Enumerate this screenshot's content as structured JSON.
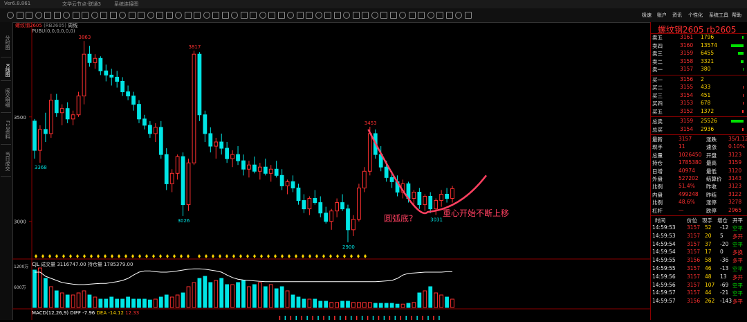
{
  "topbar": {
    "app": "Ver6.8.861",
    "account": "文华云节点-联通3",
    "status": "系统连接图"
  },
  "menu": [
    "极速",
    "账户",
    "资讯",
    "个性化",
    "系统工具",
    "帮助"
  ],
  "sidebar_tabs": [
    "分时图",
    "K线图",
    "成交明细",
    "F10资料",
    "当日成交"
  ],
  "chart_header": {
    "name": "螺纹钢2605",
    "ref": "(RB2605)",
    "period": "周线",
    "indicator": "PUBU(0,0,0,0,0,0)"
  },
  "annotations": {
    "high1": "3863",
    "high2": "3817",
    "high3": "3453",
    "low1": "3368",
    "low2": "3026",
    "low3": "3031",
    "low4": "2900",
    "arc_label": "圆弧底?",
    "trend_label": "重心开始不断上移"
  },
  "price_axis": [
    "3500",
    "3000"
  ],
  "volume_header": {
    "label": "CJL",
    "volume_text": "成交量 3116747.00",
    "oi_text": "持仓量 1785379.00"
  },
  "volume_axis": [
    "1200万",
    "600万"
  ],
  "macd_header": {
    "label": "MACD(12,26,9)",
    "diff": "DIFF -7.96",
    "dea": "DEA -14.12",
    "macd": "12.33"
  },
  "quote": {
    "title": "螺纹钢2605  rb2605",
    "asks": [
      {
        "label": "卖五",
        "price": "3161",
        "vol": "1796",
        "bar": 0.1
      },
      {
        "label": "卖四",
        "price": "3160",
        "vol": "13574",
        "bar": 1.0
      },
      {
        "label": "卖三",
        "price": "3159",
        "vol": "6455",
        "bar": 0.45
      },
      {
        "label": "卖二",
        "price": "3158",
        "vol": "3321",
        "bar": 0.25
      },
      {
        "label": "卖一",
        "price": "3157",
        "vol": "380",
        "bar": 0.03
      }
    ],
    "bids": [
      {
        "label": "买一",
        "price": "3156",
        "vol": "2",
        "bar": 0
      },
      {
        "label": "买二",
        "price": "3155",
        "vol": "433",
        "bar": 0.03
      },
      {
        "label": "买三",
        "price": "3154",
        "vol": "451",
        "bar": 0.03
      },
      {
        "label": "买四",
        "price": "3153",
        "vol": "678",
        "bar": 0.05
      },
      {
        "label": "买五",
        "price": "3152",
        "vol": "1372",
        "bar": 0.1
      }
    ],
    "totals": [
      {
        "label": "总卖",
        "price": "3159",
        "vol": "25526"
      },
      {
        "label": "总买",
        "price": "3154",
        "vol": "2936"
      }
    ],
    "stats": [
      [
        "最新",
        "3157",
        "涨跌",
        "35/1.12%"
      ],
      [
        "现手",
        "11",
        "速涨",
        "0.10%"
      ],
      [
        "总量",
        "1026450",
        "开盘",
        "3123"
      ],
      [
        "持仓",
        "1785380",
        "最高",
        "3159"
      ],
      [
        "日增",
        "40974",
        "最低",
        "3120"
      ],
      [
        "外盘",
        "527202",
        "结算价",
        "3143"
      ],
      [
        "比例",
        "51.4%",
        "昨收",
        "3123"
      ],
      [
        "内盘",
        "499248",
        "昨结",
        "3122"
      ],
      [
        "比例",
        "48.6%",
        "涨停",
        "3278"
      ],
      [
        "杠杆",
        "—",
        "跌停",
        "2965"
      ]
    ],
    "trade_header": [
      "时间",
      "价位",
      "现手",
      "增仓",
      "开平"
    ],
    "trades": [
      [
        "14:59:53",
        "3157",
        "52",
        "-12",
        "空平"
      ],
      [
        "14:59:53",
        "3157",
        "20",
        "5",
        "多开"
      ],
      [
        "14:59:54",
        "3157",
        "37",
        "-20",
        "空平"
      ],
      [
        "14:59:54",
        "3157",
        "17",
        "0",
        "多换"
      ],
      [
        "14:59:55",
        "3156",
        "58",
        "-36",
        "多平"
      ],
      [
        "14:59:55",
        "3157",
        "46",
        "-13",
        "空平"
      ],
      [
        "14:59:56",
        "3157",
        "48",
        "13",
        "多开"
      ],
      [
        "14:59:56",
        "3157",
        "107",
        "-69",
        "空平"
      ],
      [
        "14:59:57",
        "3157",
        "44",
        "-21",
        "空平"
      ],
      [
        "14:59:57",
        "3156",
        "262",
        "-143",
        "多平"
      ]
    ]
  },
  "chart_data": {
    "type": "candlestick",
    "ylim": [
      2860,
      3920
    ],
    "candles": [
      [
        3480,
        3490,
        3300,
        3340
      ],
      [
        3340,
        3460,
        3280,
        3440
      ],
      [
        3440,
        3520,
        3380,
        3420
      ],
      [
        3420,
        3610,
        3400,
        3580
      ],
      [
        3580,
        3610,
        3500,
        3520
      ],
      [
        3520,
        3560,
        3460,
        3540
      ],
      [
        3540,
        3570,
        3470,
        3490
      ],
      [
        3490,
        3530,
        3460,
        3510
      ],
      [
        3510,
        3620,
        3500,
        3600
      ],
      [
        3600,
        3863,
        3560,
        3800
      ],
      [
        3800,
        3840,
        3740,
        3760
      ],
      [
        3760,
        3800,
        3730,
        3780
      ],
      [
        3780,
        3790,
        3700,
        3720
      ],
      [
        3720,
        3750,
        3670,
        3700
      ],
      [
        3700,
        3730,
        3650,
        3690
      ],
      [
        3690,
        3720,
        3640,
        3670
      ],
      [
        3670,
        3690,
        3600,
        3620
      ],
      [
        3620,
        3650,
        3580,
        3600
      ],
      [
        3600,
        3620,
        3530,
        3560
      ],
      [
        3560,
        3580,
        3470,
        3490
      ],
      [
        3490,
        3510,
        3440,
        3460
      ],
      [
        3460,
        3480,
        3400,
        3420
      ],
      [
        3420,
        3470,
        3380,
        3450
      ],
      [
        3450,
        3480,
        3300,
        3320
      ],
      [
        3320,
        3350,
        3150,
        3180
      ],
      [
        3180,
        3250,
        3140,
        3230
      ],
      [
        3230,
        3320,
        3200,
        3310
      ],
      [
        3310,
        3330,
        3026,
        3080
      ],
      [
        3080,
        3300,
        3050,
        3280
      ],
      [
        3280,
        3817,
        3270,
        3800
      ],
      [
        3800,
        3810,
        3480,
        3510
      ],
      [
        3510,
        3530,
        3380,
        3420
      ],
      [
        3420,
        3450,
        3330,
        3360
      ],
      [
        3360,
        3400,
        3300,
        3380
      ],
      [
        3380,
        3420,
        3320,
        3350
      ],
      [
        3350,
        3380,
        3280,
        3300
      ],
      [
        3300,
        3340,
        3260,
        3320
      ],
      [
        3320,
        3360,
        3270,
        3290
      ],
      [
        3290,
        3320,
        3220,
        3250
      ],
      [
        3250,
        3290,
        3210,
        3270
      ],
      [
        3270,
        3310,
        3230,
        3240
      ],
      [
        3240,
        3280,
        3200,
        3260
      ],
      [
        3260,
        3300,
        3220,
        3230
      ],
      [
        3230,
        3270,
        3190,
        3250
      ],
      [
        3250,
        3290,
        3210,
        3220
      ],
      [
        3220,
        3250,
        3150,
        3170
      ],
      [
        3170,
        3200,
        3130,
        3190
      ],
      [
        3190,
        3220,
        3140,
        3160
      ],
      [
        3160,
        3180,
        3080,
        3100
      ],
      [
        3100,
        3130,
        3040,
        3060
      ],
      [
        3060,
        3120,
        3030,
        3110
      ],
      [
        3110,
        3150,
        3080,
        3090
      ],
      [
        3090,
        3120,
        3020,
        3040
      ],
      [
        3040,
        3070,
        2990,
        3000
      ],
      [
        3000,
        3060,
        2960,
        3050
      ],
      [
        3050,
        3110,
        3020,
        3090
      ],
      [
        3090,
        3130,
        3050,
        3060
      ],
      [
        3060,
        3080,
        2900,
        2960
      ],
      [
        2960,
        3030,
        2930,
        3010
      ],
      [
        3010,
        3180,
        3000,
        3160
      ],
      [
        3160,
        3260,
        3140,
        3240
      ],
      [
        3240,
        3453,
        3220,
        3420
      ],
      [
        3420,
        3440,
        3300,
        3320
      ],
      [
        3320,
        3360,
        3240,
        3260
      ],
      [
        3260,
        3290,
        3190,
        3210
      ],
      [
        3210,
        3240,
        3160,
        3190
      ],
      [
        3190,
        3220,
        3120,
        3140
      ],
      [
        3140,
        3200,
        3110,
        3180
      ],
      [
        3180,
        3190,
        3090,
        3110
      ],
      [
        3110,
        3150,
        3080,
        3140
      ],
      [
        3140,
        3160,
        3060,
        3080
      ],
      [
        3080,
        3130,
        3050,
        3120
      ],
      [
        3120,
        3140,
        3040,
        3060
      ],
      [
        3060,
        3110,
        3031,
        3100
      ],
      [
        3100,
        3150,
        3070,
        3130
      ],
      [
        3130,
        3160,
        3090,
        3110
      ],
      [
        3110,
        3170,
        3090,
        3157
      ]
    ],
    "volume": [
      0.9,
      0.95,
      0.7,
      0.5,
      0.4,
      0.35,
      0.3,
      0.3,
      0.35,
      0.4,
      0.3,
      0.25,
      0.2,
      0.2,
      0.25,
      0.2,
      0.2,
      0.25,
      0.2,
      0.2,
      0.2,
      0.18,
      0.2,
      0.25,
      0.3,
      0.25,
      0.3,
      0.35,
      0.5,
      0.6,
      0.7,
      0.75,
      0.6,
      0.65,
      0.7,
      0.55,
      0.55,
      0.6,
      0.65,
      0.5,
      0.55,
      0.6,
      0.5,
      0.55,
      0.45,
      0.5,
      0.4,
      0.3,
      0.25,
      0.2,
      0.2,
      0.2,
      0.15,
      0.15,
      0.12,
      0.12,
      0.15,
      0.15,
      0.12,
      0.12,
      0.12,
      0.12,
      0.1,
      0.1,
      0.1,
      0.1,
      0.08,
      0.08,
      0.1,
      0.12,
      0.35,
      0.4,
      0.5,
      0.35,
      0.3,
      0.25,
      0.2
    ],
    "oi": [
      0.85,
      0.85,
      0.75,
      0.7,
      0.65,
      0.6,
      0.58,
      0.56,
      0.55,
      0.55,
      0.56,
      0.57,
      0.58,
      0.58,
      0.6,
      0.62,
      0.65,
      0.7,
      0.78,
      0.85,
      0.88,
      0.88,
      0.86,
      0.85,
      0.85,
      0.86,
      0.88,
      0.9,
      0.92,
      0.93,
      0.93,
      0.92,
      0.9,
      0.88,
      0.85,
      0.78,
      0.72,
      0.68,
      0.66,
      0.65,
      0.64,
      0.63,
      0.62,
      0.62,
      0.62,
      0.62,
      0.62,
      0.62,
      0.62,
      0.62,
      0.62,
      0.62,
      0.62,
      0.62,
      0.62,
      0.62,
      0.62,
      0.62,
      0.62,
      0.62,
      0.62,
      0.62,
      0.62,
      0.63,
      0.64,
      0.65,
      0.7,
      0.78,
      0.82,
      0.83,
      0.84,
      0.85,
      0.85,
      0.85,
      0.85,
      0.86,
      0.86
    ],
    "colors": {
      "up": "#ff3030",
      "down": "#00e5e5",
      "arc": "#ff4060"
    }
  }
}
